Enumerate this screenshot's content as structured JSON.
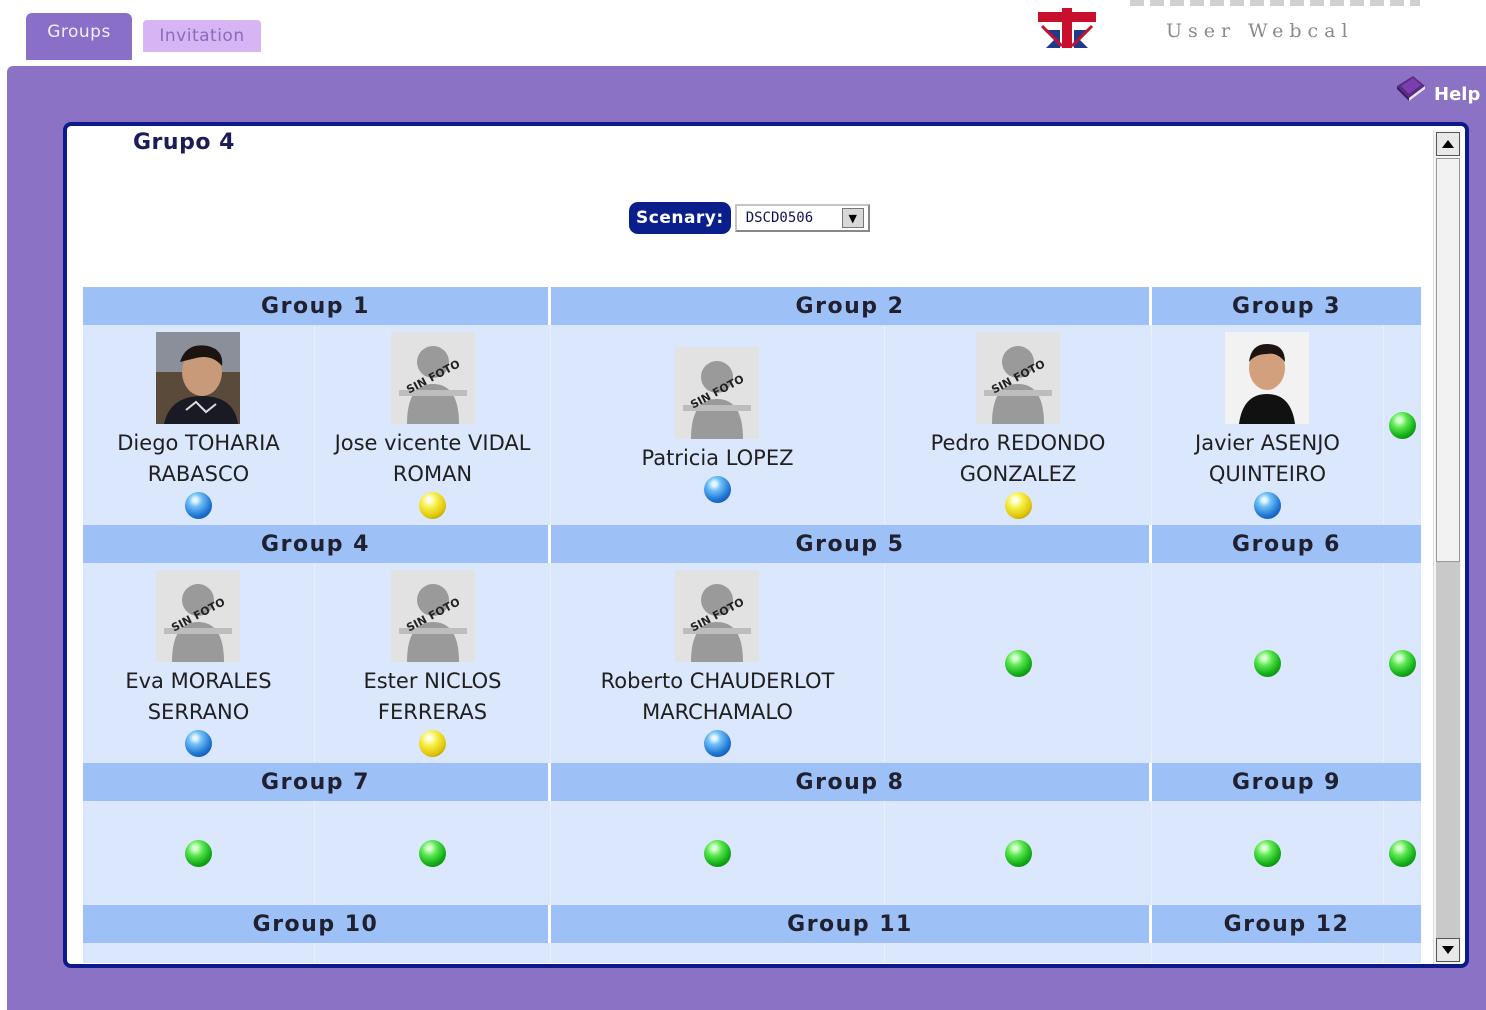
{
  "tabs": [
    {
      "label": "Groups",
      "active": true
    },
    {
      "label": "Invitation",
      "active": false
    }
  ],
  "header": {
    "brand": "User Webcal",
    "flag_icon": "uk-flag-icon"
  },
  "help": {
    "label": "Help",
    "icon": "book-icon"
  },
  "panel": {
    "title": "Grupo 4",
    "scenary_label": "Scenary:",
    "scenary_value": "DSCD0506"
  },
  "colors": {
    "frame": "#8c72c4",
    "panel_border": "#0c1a8a",
    "header_bg": "#9dc1f7",
    "cell_bg": "#dae7fc",
    "blue_status": "#1f76d4",
    "yellow_status": "#e0c60a",
    "green_status": "#16b11a"
  },
  "group_rows": [
    {
      "headers": [
        "Group 1",
        "Group 2",
        "Group 3"
      ],
      "cells": [
        {
          "name": [
            "Diego TOHARIA",
            "RABASCO"
          ],
          "photo": "real-photo",
          "status": "blue"
        },
        {
          "name": [
            "Jose vicente VIDAL",
            "ROMAN"
          ],
          "photo": "sin-foto",
          "status": "yellow"
        },
        {
          "name": [
            "Patricia LOPEZ"
          ],
          "photo": "sin-foto",
          "status": "blue"
        },
        {
          "name": [
            "Pedro REDONDO",
            "GONZALEZ"
          ],
          "photo": "sin-foto",
          "status": "yellow"
        },
        {
          "name": [
            "Javier ASENJO",
            "QUINTEIRO"
          ],
          "photo": "real-photo-2",
          "status": "blue"
        },
        {
          "name": [],
          "photo": null,
          "status": "green"
        }
      ]
    },
    {
      "headers": [
        "Group 4",
        "Group 5",
        "Group 6"
      ],
      "cells": [
        {
          "name": [
            "Eva MORALES",
            "SERRANO"
          ],
          "photo": "sin-foto",
          "status": "blue"
        },
        {
          "name": [
            "Ester NICLOS",
            "FERRERAS"
          ],
          "photo": "sin-foto",
          "status": "yellow"
        },
        {
          "name": [
            "Roberto CHAUDERLOT",
            "MARCHAMALO"
          ],
          "photo": "sin-foto",
          "status": "blue"
        },
        {
          "name": [],
          "photo": null,
          "status": "green"
        },
        {
          "name": [],
          "photo": null,
          "status": "green"
        },
        {
          "name": [],
          "photo": null,
          "status": "green"
        }
      ]
    },
    {
      "headers": [
        "Group 7",
        "Group 8",
        "Group 9"
      ],
      "cells": [
        {
          "name": [],
          "photo": null,
          "status": "green"
        },
        {
          "name": [],
          "photo": null,
          "status": "green"
        },
        {
          "name": [],
          "photo": null,
          "status": "green"
        },
        {
          "name": [],
          "photo": null,
          "status": "green"
        },
        {
          "name": [],
          "photo": null,
          "status": "green"
        },
        {
          "name": [],
          "photo": null,
          "status": "green"
        }
      ]
    },
    {
      "headers": [
        "Group 10",
        "Group 11",
        "Group 12"
      ],
      "cells": []
    }
  ],
  "photo_placeholder_text": "SIN FOTO"
}
